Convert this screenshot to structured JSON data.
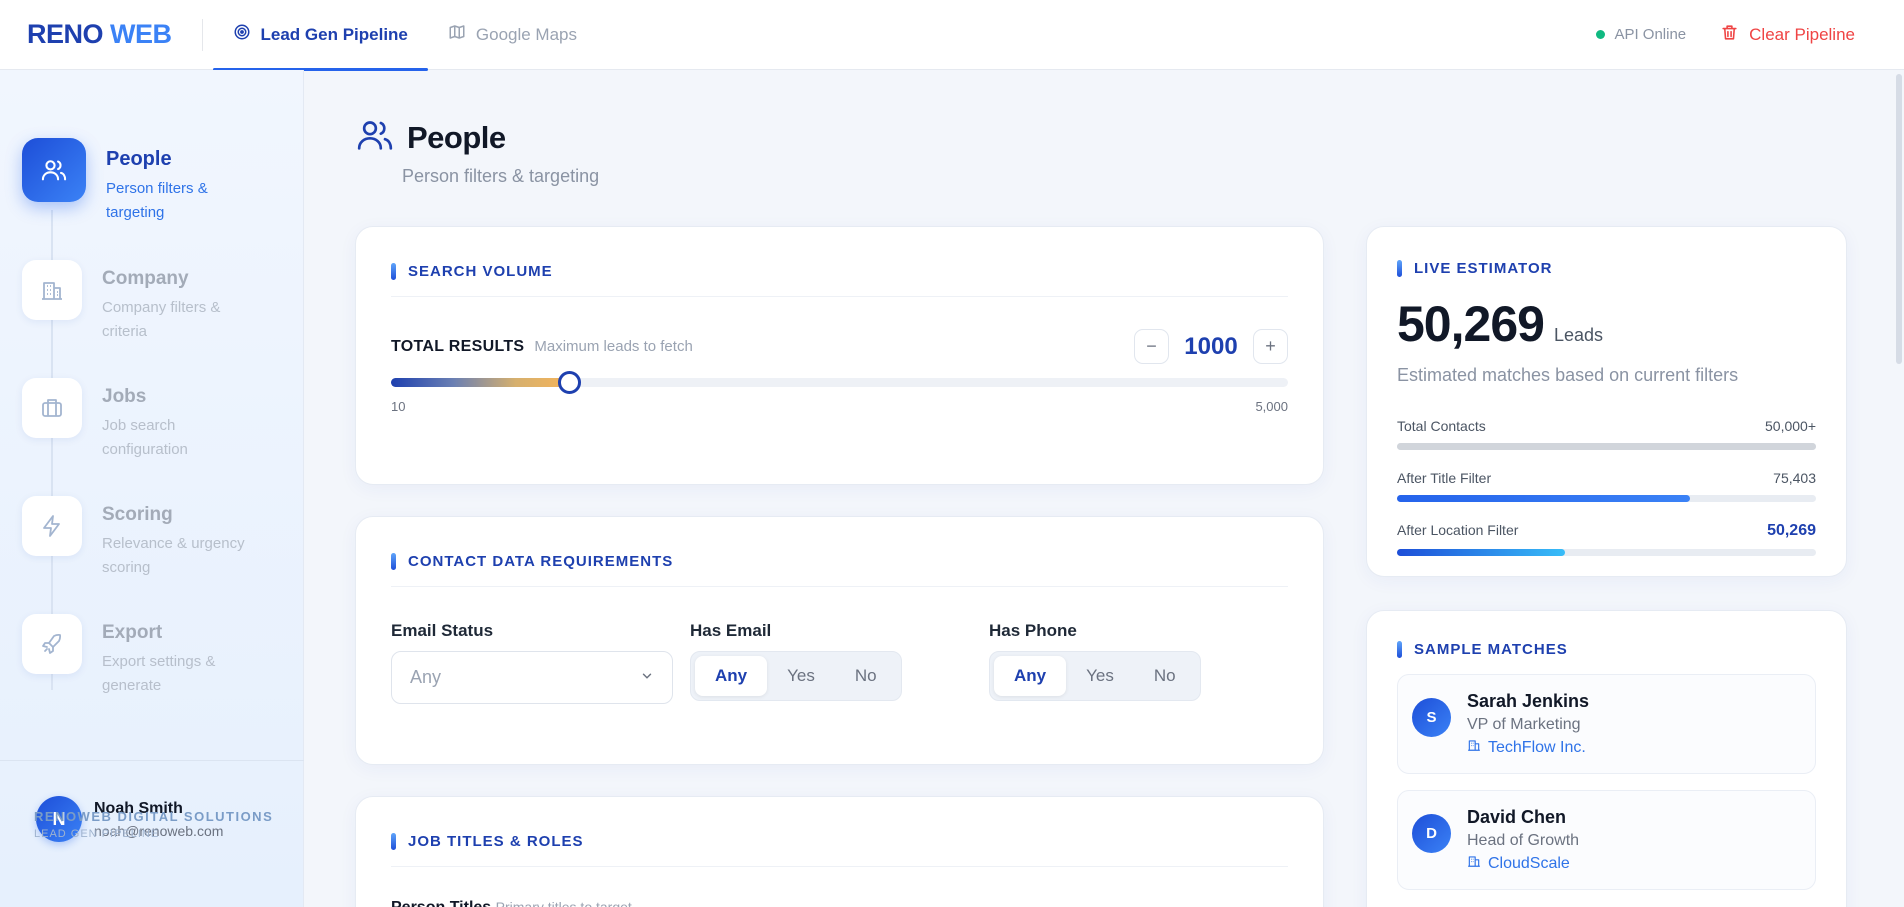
{
  "brand": {
    "part1": "RENO",
    "part2": "WEB"
  },
  "nav": {
    "tabs": [
      {
        "label": "Lead Gen Pipeline",
        "icon": "target-icon",
        "active": true
      },
      {
        "label": "Google Maps",
        "icon": "map-icon",
        "active": false
      }
    ],
    "api_status": "API Online",
    "clear_label": "Clear Pipeline"
  },
  "sidebar": {
    "steps": [
      {
        "title": "People",
        "subtitle": "Person filters & targeting",
        "icon": "users-icon",
        "active": true
      },
      {
        "title": "Company",
        "subtitle": "Company filters & criteria",
        "icon": "building-icon",
        "active": false
      },
      {
        "title": "Jobs",
        "subtitle": "Job search configuration",
        "icon": "briefcase-icon",
        "active": false
      },
      {
        "title": "Scoring",
        "subtitle": "Relevance & urgency scoring",
        "icon": "bolt-icon",
        "active": false
      },
      {
        "title": "Export",
        "subtitle": "Export settings & generate",
        "icon": "rocket-icon",
        "active": false
      }
    ],
    "user": {
      "initial": "N",
      "name": "Noah Smith",
      "email": "noah@renoweb.com"
    },
    "org": {
      "name": "RENOWEB DIGITAL SOLUTIONS",
      "sub": "LEAD GEN PIPELINE"
    }
  },
  "page": {
    "title": "People",
    "subtitle": "Person filters & targeting"
  },
  "search_volume": {
    "heading": "SEARCH VOLUME",
    "label": "TOTAL RESULTS",
    "hint": "Maximum leads to fetch",
    "minus": "−",
    "plus": "+",
    "value": "1000",
    "min_label": "10",
    "max_label": "5,000",
    "slider_fraction": 0.198
  },
  "contact_data": {
    "heading": "CONTACT DATA REQUIREMENTS",
    "email_status": {
      "label": "Email Status",
      "value": "Any"
    },
    "has_email": {
      "label": "Has Email",
      "options": [
        "Any",
        "Yes",
        "No"
      ],
      "selected": "Any"
    },
    "has_phone": {
      "label": "Has Phone",
      "options": [
        "Any",
        "Yes",
        "No"
      ],
      "selected": "Any"
    }
  },
  "job_titles": {
    "heading": "JOB TITLES & ROLES",
    "field_label": "Person Titles",
    "field_hint": "Primary titles to target"
  },
  "estimator": {
    "heading": "LIVE ESTIMATOR",
    "value": "50,269",
    "unit": "Leads",
    "subtitle": "Estimated matches based on current filters",
    "rows": [
      {
        "label": "Total Contacts",
        "value": "50,000+",
        "fraction": 1.0,
        "color": "#d1d5db"
      },
      {
        "label": "After Title Filter",
        "value": "75,403",
        "fraction": 0.7,
        "color": "#3b82f6"
      },
      {
        "label": "After Location Filter",
        "value": "50,269",
        "fraction": 0.4,
        "color": "#38bdf8"
      }
    ]
  },
  "sample_matches": {
    "heading": "SAMPLE MATCHES",
    "items": [
      {
        "initial": "S",
        "name": "Sarah Jenkins",
        "title": "VP of Marketing",
        "company": "TechFlow Inc."
      },
      {
        "initial": "D",
        "name": "David Chen",
        "title": "Head of Growth",
        "company": "CloudScale"
      }
    ]
  }
}
